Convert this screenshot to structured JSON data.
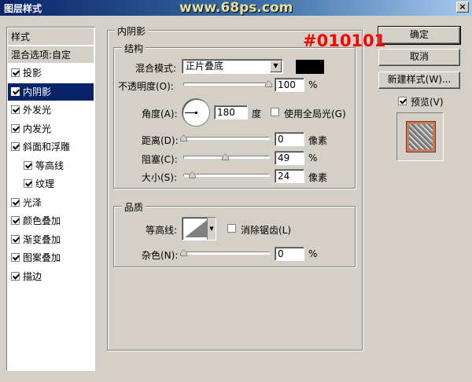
{
  "window": {
    "title": "图层样式",
    "watermark": "www.68ps.com",
    "close_label": "×"
  },
  "annotation": "#010101",
  "styles_list": {
    "header": "样式",
    "blend_options": "混合选项:自定",
    "items": [
      {
        "label": "投影",
        "checked": true
      },
      {
        "label": "内阴影",
        "checked": true,
        "selected": true
      },
      {
        "label": "外发光",
        "checked": true
      },
      {
        "label": "内发光",
        "checked": true
      },
      {
        "label": "斜面和浮雕",
        "checked": true
      },
      {
        "label": "等高线",
        "checked": true
      },
      {
        "label": "纹理",
        "checked": true
      },
      {
        "label": "光泽",
        "checked": true
      },
      {
        "label": "颜色叠加",
        "checked": true
      },
      {
        "label": "渐变叠加",
        "checked": true
      },
      {
        "label": "图案叠加",
        "checked": true
      },
      {
        "label": "描边",
        "checked": true
      }
    ]
  },
  "inner_shadow": {
    "title": "内阴影",
    "structure": {
      "title": "结构",
      "blend_mode_label": "混合模式:",
      "blend_mode_value": "正片叠底",
      "color": "#000000",
      "opacity_label": "不透明度(O):",
      "opacity_value": "100",
      "opacity_unit": "%",
      "opacity_level": 1.0,
      "angle_label": "角度(A):",
      "angle_value": "180",
      "angle_unit": "度",
      "global_light_label": "使用全局光(G)",
      "global_light_checked": false,
      "distance_label": "距离(D):",
      "distance_value": "0",
      "distance_unit": "像素",
      "distance_level": 0.0,
      "choke_label": "阻塞(C):",
      "choke_value": "49",
      "choke_unit": "%",
      "choke_level": 0.49,
      "size_label": "大小(S):",
      "size_value": "24",
      "size_unit": "像素",
      "size_level": 0.1
    },
    "quality": {
      "title": "品质",
      "contour_label": "等高线:",
      "anti_alias_label": "消除锯齿(L)",
      "anti_alias_checked": false,
      "noise_label": "杂色(N):",
      "noise_value": "0",
      "noise_unit": "%",
      "noise_level": 0.0
    }
  },
  "buttons": {
    "ok": "确定",
    "cancel": "取消",
    "new_style": "新建样式(W)...",
    "preview_label": "预览(V)",
    "preview_checked": true
  }
}
